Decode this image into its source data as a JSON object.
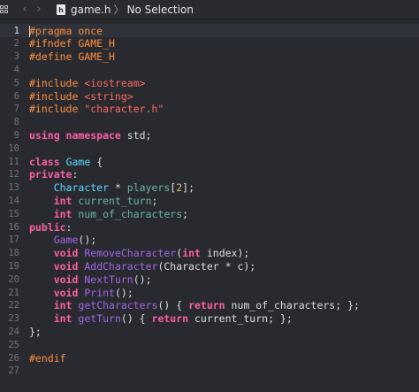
{
  "colors": {
    "background": "#292a30",
    "keyword": "#fc5fa3",
    "preprocessor": "#fd8f3f",
    "string": "#fc6a5d",
    "number": "#d0bf69",
    "type": "#5dd8ff",
    "function": "#a167e6",
    "member": "#67b7a4",
    "plain": "#dfdfe0"
  },
  "jumpbar": {
    "grid_icon": "grid-icon",
    "back_icon": "chevron-left-icon",
    "forward_icon": "chevron-right-icon",
    "back_glyph": "‹",
    "forward_glyph": "›",
    "file_icon_letter": "h",
    "file_name": "game.h",
    "separator": "〉",
    "selection": "No Selection"
  },
  "editor": {
    "current_line": 1,
    "lines": [
      {
        "n": "1",
        "tokens": [
          [
            "pp",
            "#pragma once"
          ]
        ]
      },
      {
        "n": "2",
        "tokens": [
          [
            "pp",
            "#ifndef GAME_H"
          ]
        ]
      },
      {
        "n": "3",
        "tokens": [
          [
            "pp",
            "#define GAME_H"
          ]
        ]
      },
      {
        "n": "4",
        "tokens": []
      },
      {
        "n": "5",
        "tokens": [
          [
            "pp",
            "#include "
          ],
          [
            "str",
            "<iostream>"
          ]
        ]
      },
      {
        "n": "6",
        "tokens": [
          [
            "pp",
            "#include "
          ],
          [
            "str",
            "<string>"
          ]
        ]
      },
      {
        "n": "7",
        "tokens": [
          [
            "pp",
            "#include "
          ],
          [
            "str",
            "\"character.h\""
          ]
        ]
      },
      {
        "n": "8",
        "tokens": []
      },
      {
        "n": "9",
        "tokens": [
          [
            "kw",
            "using namespace"
          ],
          [
            "plain",
            " std;"
          ]
        ]
      },
      {
        "n": "10",
        "tokens": []
      },
      {
        "n": "11",
        "tokens": [
          [
            "kw",
            "class"
          ],
          [
            "plain",
            " "
          ],
          [
            "type",
            "Game"
          ],
          [
            "plain",
            " {"
          ]
        ]
      },
      {
        "n": "12",
        "tokens": [
          [
            "kw",
            "private"
          ],
          [
            "plain",
            ":"
          ]
        ]
      },
      {
        "n": "13",
        "tokens": [
          [
            "plain",
            "    "
          ],
          [
            "type",
            "Character"
          ],
          [
            "plain",
            " * "
          ],
          [
            "var",
            "players"
          ],
          [
            "plain",
            "["
          ],
          [
            "num",
            "2"
          ],
          [
            "plain",
            "];"
          ]
        ]
      },
      {
        "n": "14",
        "tokens": [
          [
            "plain",
            "    "
          ],
          [
            "kw",
            "int"
          ],
          [
            "plain",
            " "
          ],
          [
            "var",
            "current_turn"
          ],
          [
            "plain",
            ";"
          ]
        ]
      },
      {
        "n": "15",
        "tokens": [
          [
            "plain",
            "    "
          ],
          [
            "kw",
            "int"
          ],
          [
            "plain",
            " "
          ],
          [
            "var",
            "num_of_characters"
          ],
          [
            "plain",
            ";"
          ]
        ]
      },
      {
        "n": "16",
        "tokens": [
          [
            "kw",
            "public"
          ],
          [
            "plain",
            ":"
          ]
        ]
      },
      {
        "n": "17",
        "tokens": [
          [
            "plain",
            "    "
          ],
          [
            "fn",
            "Game"
          ],
          [
            "plain",
            "();"
          ]
        ]
      },
      {
        "n": "18",
        "tokens": [
          [
            "plain",
            "    "
          ],
          [
            "kw",
            "void"
          ],
          [
            "plain",
            " "
          ],
          [
            "fn",
            "RemoveCharacter"
          ],
          [
            "plain",
            "("
          ],
          [
            "kw",
            "int"
          ],
          [
            "plain",
            " index);"
          ]
        ]
      },
      {
        "n": "19",
        "tokens": [
          [
            "plain",
            "    "
          ],
          [
            "kw",
            "void"
          ],
          [
            "plain",
            " "
          ],
          [
            "fn",
            "AddCharacter"
          ],
          [
            "plain",
            "(Character * c);"
          ]
        ]
      },
      {
        "n": "20",
        "tokens": [
          [
            "plain",
            "    "
          ],
          [
            "kw",
            "void"
          ],
          [
            "plain",
            " "
          ],
          [
            "fn",
            "NextTurn"
          ],
          [
            "plain",
            "();"
          ]
        ]
      },
      {
        "n": "21",
        "tokens": [
          [
            "plain",
            "    "
          ],
          [
            "kw",
            "void"
          ],
          [
            "plain",
            " "
          ],
          [
            "fn",
            "Print"
          ],
          [
            "plain",
            "();"
          ]
        ]
      },
      {
        "n": "22",
        "tokens": [
          [
            "plain",
            "    "
          ],
          [
            "kw",
            "int"
          ],
          [
            "plain",
            " "
          ],
          [
            "fn",
            "getCharacters"
          ],
          [
            "plain",
            "() { "
          ],
          [
            "kw",
            "return"
          ],
          [
            "plain",
            " num_of_characters; };"
          ]
        ]
      },
      {
        "n": "23",
        "tokens": [
          [
            "plain",
            "    "
          ],
          [
            "kw",
            "int"
          ],
          [
            "plain",
            " "
          ],
          [
            "fn",
            "getTurn"
          ],
          [
            "plain",
            "() { "
          ],
          [
            "kw",
            "return"
          ],
          [
            "plain",
            " current_turn; };"
          ]
        ]
      },
      {
        "n": "24",
        "tokens": [
          [
            "plain",
            "};"
          ]
        ]
      },
      {
        "n": "25",
        "tokens": []
      },
      {
        "n": "26",
        "tokens": [
          [
            "pp",
            "#endif"
          ]
        ]
      },
      {
        "n": "27",
        "tokens": []
      }
    ]
  }
}
